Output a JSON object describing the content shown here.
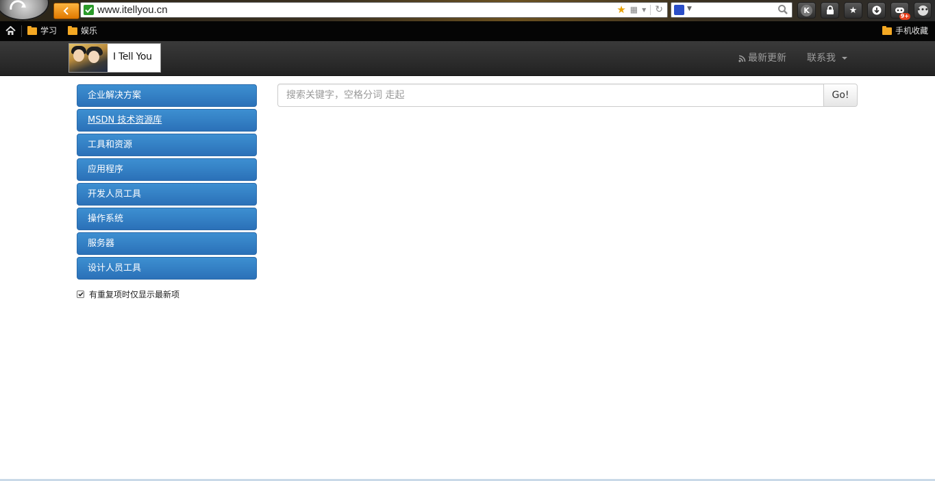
{
  "browser": {
    "url": "www.itellyou.cn",
    "toolbar_buttons": [
      "K",
      "lock-icon",
      "star-icon",
      "download-icon",
      "game-icon",
      "more-icon"
    ],
    "game_badge": "9+",
    "bookmarks": [
      {
        "label": "学习",
        "icon": "folder-icon"
      },
      {
        "label": "娱乐",
        "icon": "folder-icon"
      }
    ],
    "mobile_favorites": "手机收藏"
  },
  "navbar": {
    "logo_text": "I Tell You",
    "latest_updates": "最新更新",
    "contact": "联系我"
  },
  "sidebar": {
    "items": [
      {
        "label": "企业解决方案"
      },
      {
        "label": "MSDN 技术资源库"
      },
      {
        "label": "工具和资源"
      },
      {
        "label": "应用程序"
      },
      {
        "label": "开发人员工具"
      },
      {
        "label": "操作系统"
      },
      {
        "label": "服务器"
      },
      {
        "label": "设计人员工具"
      }
    ],
    "checkbox_label": "有重复项时仅显示最新项",
    "checkbox_checked": true
  },
  "search": {
    "placeholder": "搜索关键字，空格分词 走起",
    "button_label": "Go!"
  },
  "colors": {
    "sidebar_button": "#337ab7",
    "navbar_bg": "#222222",
    "back_button": "#f08a00"
  }
}
